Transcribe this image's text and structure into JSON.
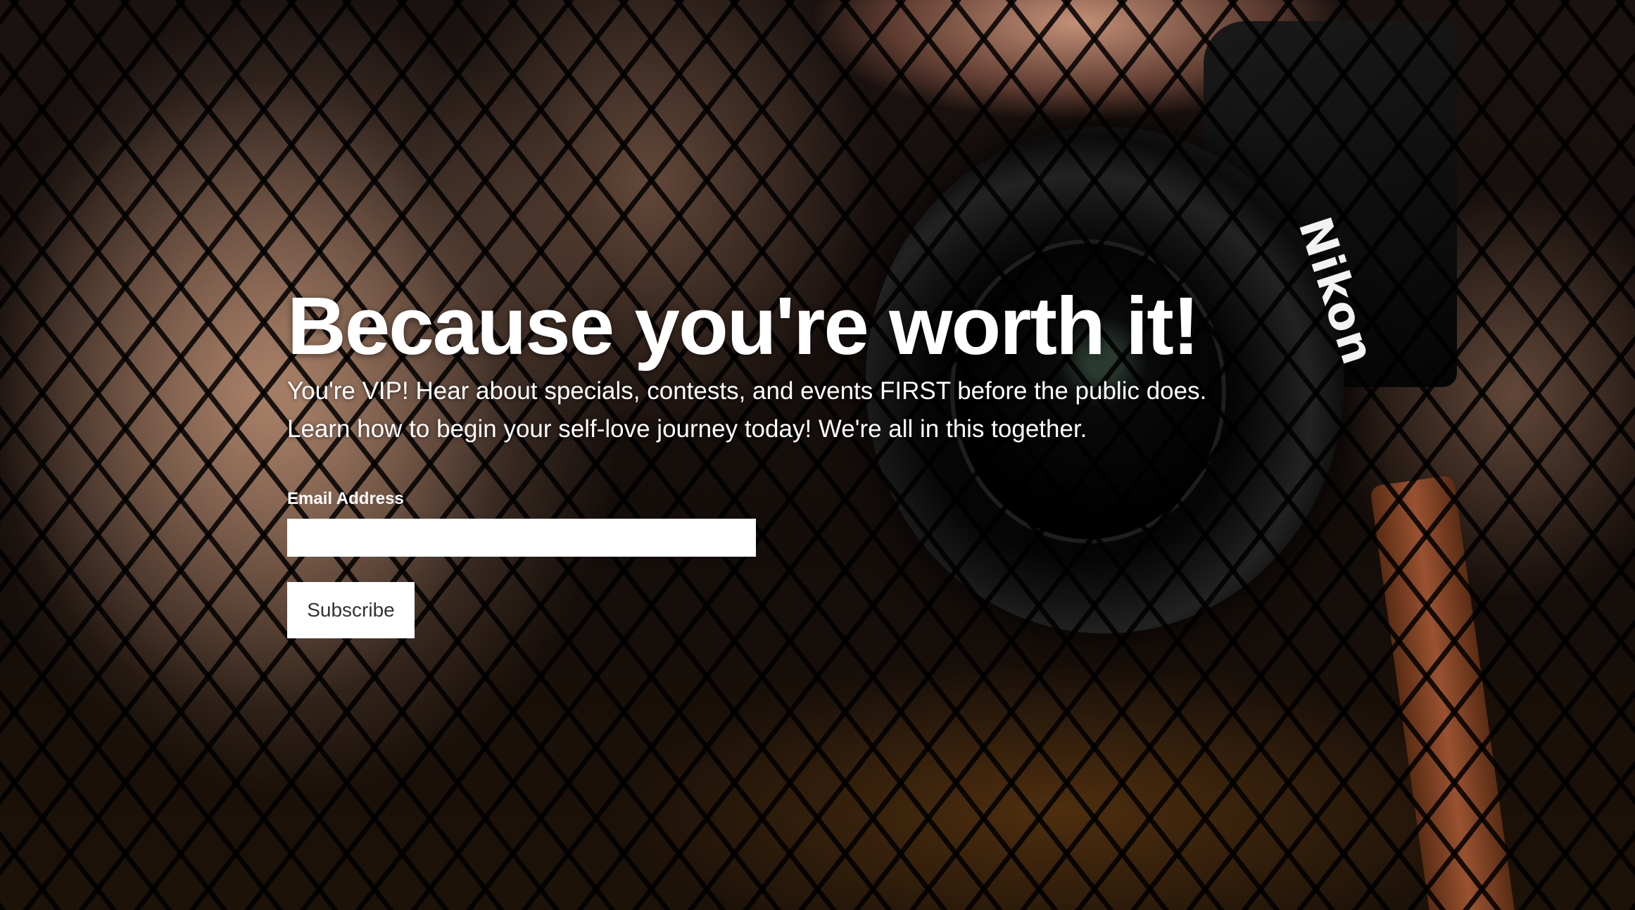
{
  "hero": {
    "headline": "Because you're worth it!",
    "subtext_line1": "You're VIP! Hear about specials, contests, and events FIRST before the public does.",
    "subtext_line2": "Learn how to begin your self-love journey today! We're all in this together.",
    "background_image": {
      "brand_text": "Nikon"
    }
  },
  "signup_form": {
    "email_label": "Email Address",
    "email_value": "",
    "email_placeholder": "",
    "subscribe_label": "Subscribe"
  },
  "colors": {
    "text": "#ffffff",
    "input_background": "#ffffff",
    "button_background": "#ffffff",
    "button_text": "#333333"
  }
}
